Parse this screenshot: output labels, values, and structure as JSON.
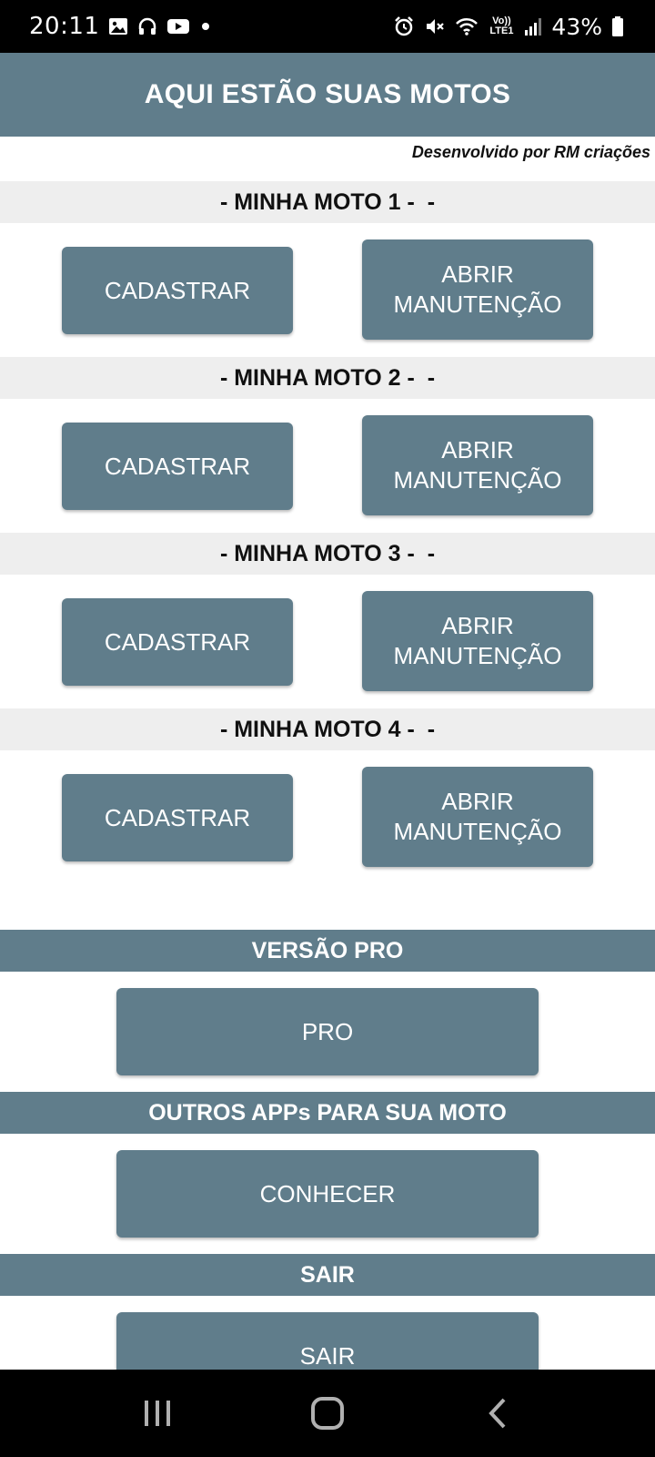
{
  "status_bar": {
    "time": "20:11",
    "battery_percent": "43%",
    "volte_label": "Vo)) LTE1",
    "icons": [
      "image-icon",
      "headphones-icon",
      "youtube-icon",
      "dot-icon",
      "alarm-icon",
      "mute-icon",
      "wifi-icon",
      "signal-icon",
      "battery-icon"
    ]
  },
  "app_bar": {
    "title": "AQUI ESTÃO SUAS MOTOS"
  },
  "credit": "Desenvolvido por RM criações",
  "motos": [
    {
      "header": "- MINHA MOTO 1 -  -",
      "register_label": "CADASTRAR",
      "open_label": "ABRIR MANUTENÇÃO"
    },
    {
      "header": "- MINHA MOTO 2 -  -",
      "register_label": "CADASTRAR",
      "open_label": "ABRIR MANUTENÇÃO"
    },
    {
      "header": "- MINHA MOTO 3 -  -",
      "register_label": "CADASTRAR",
      "open_label": "ABRIR MANUTENÇÃO"
    },
    {
      "header": "- MINHA MOTO 4 -  -",
      "register_label": "CADASTRAR",
      "open_label": "ABRIR MANUTENÇÃO"
    }
  ],
  "pro": {
    "header": "VERSÃO PRO",
    "button_label": "PRO"
  },
  "other_apps": {
    "header": "OUTROS APPs PARA SUA MOTO",
    "button_label": "CONHECER"
  },
  "exit": {
    "header": "SAIR",
    "button_label": "SAIR"
  },
  "colors": {
    "primary": "#607d8b",
    "section_bg": "#eeeeee",
    "bars": "#000000"
  }
}
